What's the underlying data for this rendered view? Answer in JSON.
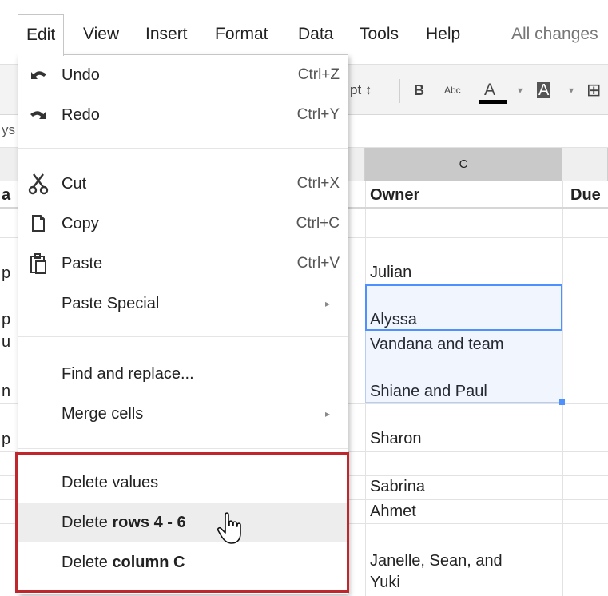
{
  "menubar": {
    "items": [
      "Edit",
      "View",
      "Insert",
      "Format",
      "Data",
      "Tools",
      "Help"
    ],
    "saved_status": "All changes"
  },
  "toolbar": {
    "font_size_suffix": "pt ↕",
    "bold": "B",
    "strike": "Abc",
    "text_color": "A",
    "fill_color": "A",
    "dropdown_arrow": "▾",
    "borders": "⊞"
  },
  "formula_bar": {
    "fragment": "ys"
  },
  "grid": {
    "column_c": "C",
    "row_partial_letters": [
      "a",
      "p",
      "p",
      "u",
      "n",
      "p"
    ],
    "cells": {
      "header_owner": "Owner",
      "header_due": "Due",
      "julian": "Julian",
      "alyssa": "Alyssa",
      "vandana": "Vandana and team",
      "shiane": "Shiane and Paul",
      "sharon": "Sharon",
      "sabrina": "Sabrina",
      "ahmet": "Ahmet",
      "janelle_1": "Janelle, Sean, and",
      "janelle_2": "Yuki"
    }
  },
  "edit_menu": {
    "undo": {
      "label": "Undo",
      "shortcut": "Ctrl+Z"
    },
    "redo": {
      "label": "Redo",
      "shortcut": "Ctrl+Y"
    },
    "cut": {
      "label": "Cut",
      "shortcut": "Ctrl+X"
    },
    "copy": {
      "label": "Copy",
      "shortcut": "Ctrl+C"
    },
    "paste": {
      "label": "Paste",
      "shortcut": "Ctrl+V"
    },
    "paste_special": {
      "label": "Paste Special",
      "arrow": "▸"
    },
    "find_replace": {
      "label": "Find and replace..."
    },
    "merge_cells": {
      "label": "Merge cells",
      "arrow": "▸"
    },
    "delete_values": {
      "label": "Delete values"
    },
    "delete_rows": {
      "prefix": "Delete ",
      "bold": "rows 4 - 6"
    },
    "delete_column": {
      "prefix": "Delete ",
      "bold": "column C"
    }
  },
  "colors": {
    "highlight_border": "#c0272d",
    "selection_border": "#4d90fe",
    "menu_hover": "#ededed"
  }
}
